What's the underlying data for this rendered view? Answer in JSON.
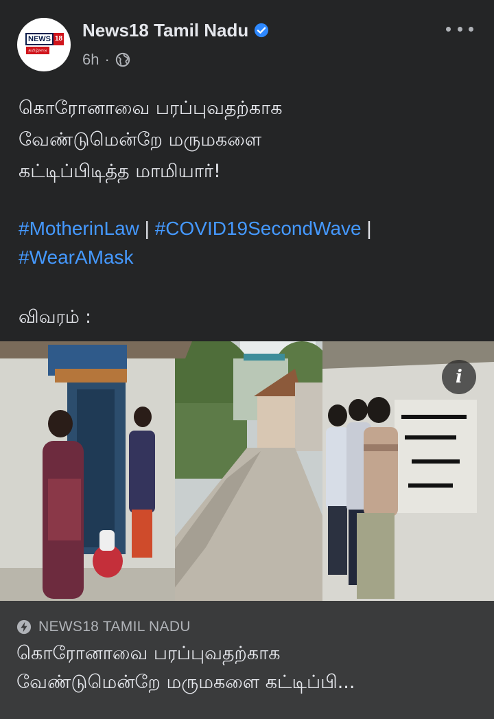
{
  "post": {
    "page_name": "News18 Tamil Nadu",
    "verified_icon": "verified-badge-icon",
    "time": "6h",
    "separator": "·",
    "privacy_icon": "globe-icon",
    "more_icon": "more-options-icon",
    "logo": {
      "brand_text": "NEWS",
      "brand_num": "18",
      "brand_sub": "தமிழ்நாடு"
    },
    "text": "கொரோனாவை பரப்புவதற்காக\nவேண்டுமென்றே மருமகளை\nகட்டிப்பிடித்த மாமியார்!",
    "hashtags": [
      "#MotherinLaw",
      "#COVID19SecondWave",
      "#WearAMask"
    ],
    "hashtag_separator": " | ",
    "details_label": "விவரம் :",
    "info_icon_text": "i"
  },
  "link_preview": {
    "source": "NEWS18 TAMIL NADU",
    "source_icon": "lightning-bolt-icon",
    "title": "கொரோனாவை பரப்புவதற்காக\nவேண்டுமென்றே மருமகளை கட்டிப்பி..."
  },
  "colors": {
    "background": "#242526",
    "link_footer": "#3a3b3c",
    "hashtag": "#4599ff",
    "verified": "#2d88ff",
    "secondary_text": "#b0b3b8"
  }
}
